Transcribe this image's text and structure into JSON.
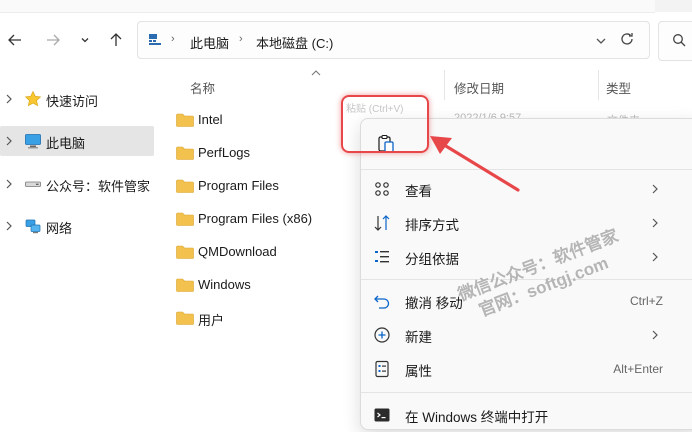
{
  "address": {
    "breadcrumbs": [
      "此电脑",
      "本地磁盘 (C:)"
    ]
  },
  "sidebar": {
    "items": [
      {
        "label": "快速访问",
        "icon": "star-icon"
      },
      {
        "label": "此电脑",
        "icon": "computer-icon"
      },
      {
        "label": "公众号：软件管家",
        "icon": "drive-icon"
      },
      {
        "label": "网络",
        "icon": "network-icon"
      }
    ]
  },
  "columns": {
    "name": "名称",
    "modified": "修改日期",
    "type": "类型"
  },
  "files": [
    "Intel",
    "PerfLogs",
    "Program Files",
    "Program Files (x86)",
    "QMDownload",
    "Windows",
    "用户"
  ],
  "peek": {
    "date": "2022/1/6 9:57",
    "type": "文件夹"
  },
  "tooltip_ghost": "粘贴 (Ctrl+V)",
  "context_menu": {
    "top_action_icon": "paste-icon",
    "items": [
      {
        "label": "查看",
        "icon": "grid-icon",
        "submenu": true
      },
      {
        "label": "排序方式",
        "icon": "sort-icon",
        "submenu": true
      },
      {
        "label": "分组依据",
        "icon": "group-icon",
        "submenu": true
      },
      {
        "label": "撤消 移动",
        "icon": "undo-icon",
        "shortcut": "Ctrl+Z"
      },
      {
        "label": "新建",
        "icon": "new-icon",
        "submenu": true
      },
      {
        "label": "属性",
        "icon": "properties-icon",
        "shortcut": "Alt+Enter"
      },
      {
        "label": "在 Windows 终端中打开",
        "icon": "terminal-icon"
      }
    ]
  },
  "watermark": {
    "line1": "微信公众号：软件管家",
    "line2": "官网：softgj.com"
  },
  "colors": {
    "highlight": "#e8474a",
    "folder": "#f2c14e",
    "accent": "#0a64c8"
  }
}
